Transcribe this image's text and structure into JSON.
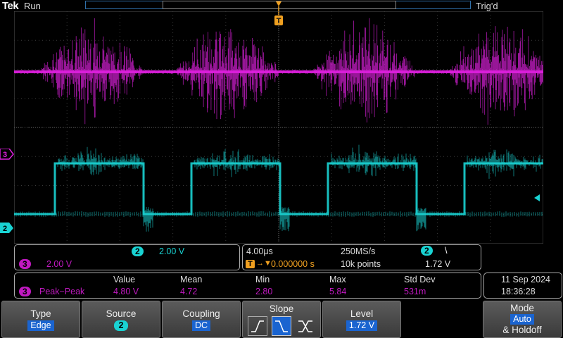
{
  "top": {
    "logo": "Tek",
    "run_status": "Run",
    "trigger_status": "Trig'd"
  },
  "markers": {
    "trigger": "T",
    "ch3": "3",
    "ch2": "2"
  },
  "ch2_panel": {
    "badge": "2",
    "scale": "2.00 V"
  },
  "ch3_panel": {
    "badge": "3",
    "scale": "2.00 V"
  },
  "timebase": {
    "horizontal_scale": "4.00μs",
    "sample_rate": "250MS/s",
    "trigger_badge": "2",
    "trigger_slope_glyph": "\\",
    "trigger_position_icon": "T",
    "position": "0.000000 s",
    "record_length": "10k points",
    "trigger_level": "1.72 V"
  },
  "measurements": {
    "headers": [
      "Value",
      "Mean",
      "Min",
      "Max",
      "Std Dev"
    ],
    "row": {
      "badge": "3",
      "name": "Peak−Peak",
      "values": [
        "4.80 V",
        "4.72",
        "2.80",
        "5.84",
        "531m"
      ]
    }
  },
  "datetime": {
    "date": "11 Sep  2024",
    "time": "18:36:28"
  },
  "menu": {
    "type": {
      "title": "Type",
      "value": "Edge"
    },
    "source": {
      "title": "Source",
      "value": "2"
    },
    "coupling": {
      "title": "Coupling",
      "value": "DC"
    },
    "slope": {
      "title": "Slope",
      "selected": "falling"
    },
    "level": {
      "title": "Level",
      "value": "1.72 V"
    },
    "mode": {
      "title": "Mode",
      "value": "Auto",
      "subtitle": "& Holdoff"
    }
  },
  "colors": {
    "ch2": "#19d3d3",
    "ch3": "#e020e0",
    "accent": "#1a64d0",
    "trigger": "#f0a020"
  }
}
